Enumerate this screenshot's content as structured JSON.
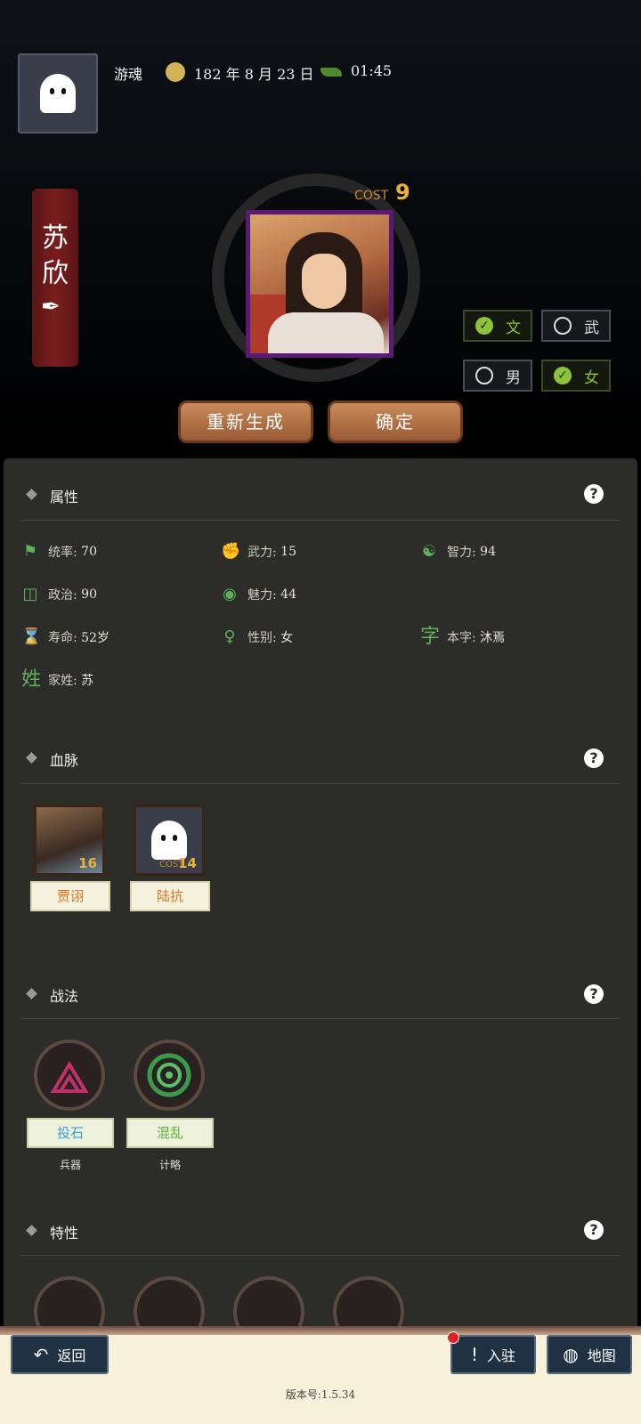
{
  "header": {
    "username": "游魂",
    "date": "182 年 8 月 23 日",
    "time": "01:45"
  },
  "character": {
    "name": "苏欣",
    "cost_label": "COST",
    "cost_value": "9"
  },
  "filters": {
    "wen": "文",
    "wu": "武",
    "male": "男",
    "female": "女"
  },
  "actions": {
    "regenerate": "重新生成",
    "confirm": "确定"
  },
  "sections": {
    "attributes": "属性",
    "bloodline": "血脉",
    "tactics": "战法",
    "traits": "特性"
  },
  "attributes": [
    {
      "key": "统率:",
      "value": "70"
    },
    {
      "key": "武力:",
      "value": "15"
    },
    {
      "key": "智力:",
      "value": "94"
    },
    {
      "key": "政治:",
      "value": "90"
    },
    {
      "key": "魅力:",
      "value": "44"
    },
    {
      "key": "寿命:",
      "value": "52岁"
    },
    {
      "key": "性别:",
      "value": "女"
    },
    {
      "key": "本字:",
      "value": "沐焉"
    },
    {
      "key": "家姓:",
      "value": "苏"
    }
  ],
  "attr_icons": {
    "style_char": "字",
    "surname_char": "姓"
  },
  "bloodline": [
    {
      "name": "贾诩",
      "cost": "16",
      "cost_label": "COST"
    },
    {
      "name": "陆抗",
      "cost": "14",
      "cost_label": "COST"
    }
  ],
  "tactics": [
    {
      "name": "投石",
      "category": "兵器",
      "color": "#3aa0d8"
    },
    {
      "name": "混乱",
      "category": "计略",
      "color": "#5fae3a"
    }
  ],
  "footer": {
    "back": "返回",
    "join": "入驻",
    "map": "地图",
    "version": "版本号:1.5.34"
  },
  "colors": {
    "accent_green": "#8cc23c",
    "cost_gold": "#e8b23c",
    "panel_bg": "#2c2d28"
  }
}
